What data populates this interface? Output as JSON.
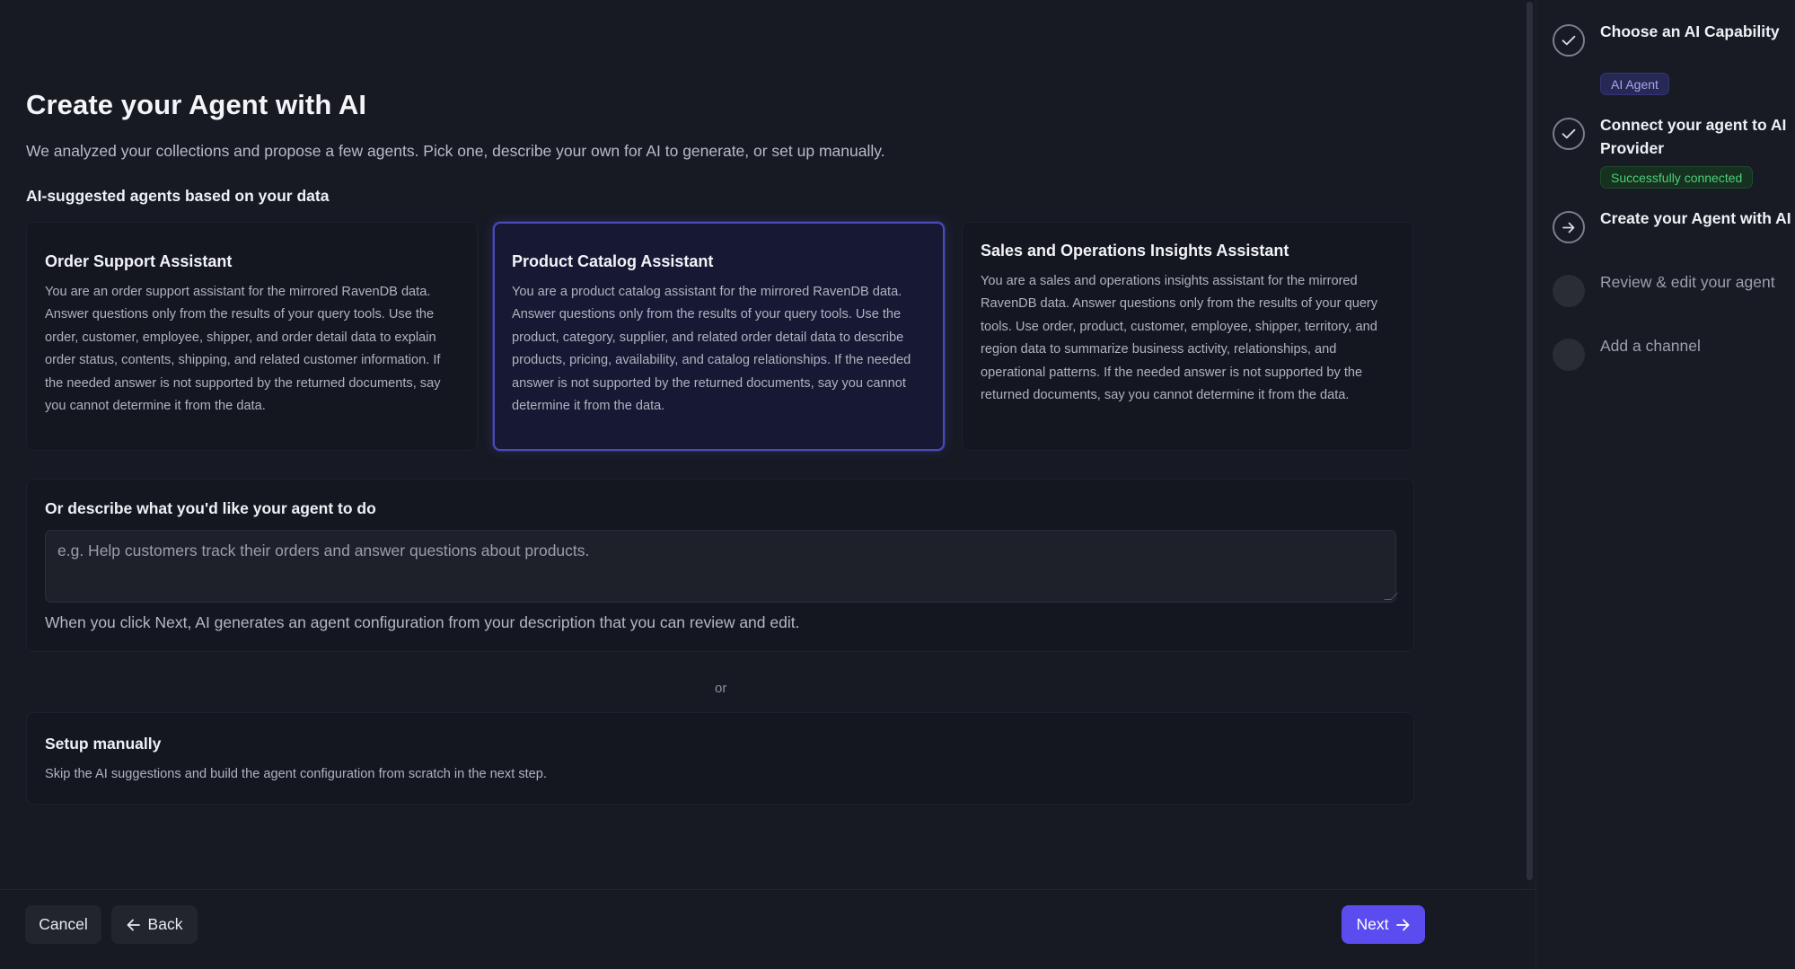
{
  "header": {
    "title": "Create your Agent with AI",
    "subtitle": "We analyzed your collections and propose a few agents. Pick one, describe your own for AI to generate, or set up manually.",
    "suggestions_label": "AI-suggested agents based on your data"
  },
  "cards": [
    {
      "title": "Order Support Assistant",
      "description": "You are an order support assistant for the mirrored RavenDB data. Answer questions only from the results of your query tools. Use the order, customer, employee, shipper, and order detail data to explain order status, contents, shipping, and related customer information. If the needed answer is not supported by the returned documents, say you cannot determine it from the data.",
      "selected": false
    },
    {
      "title": "Product Catalog Assistant",
      "description": "You are a product catalog assistant for the mirrored RavenDB data. Answer questions only from the results of your query tools. Use the product, category, supplier, and related order detail data to describe products, pricing, availability, and catalog relationships. If the needed answer is not supported by the returned documents, say you cannot determine it from the data.",
      "selected": true
    },
    {
      "title": "Sales and Operations Insights Assistant",
      "description": "You are a sales and operations insights assistant for the mirrored RavenDB data. Answer questions only from the results of your query tools. Use order, product, customer, employee, shipper, territory, and region data to summarize business activity, relationships, and operational patterns. If the needed answer is not supported by the returned documents, say you cannot determine it from the data.",
      "selected": false
    }
  ],
  "describe": {
    "label": "Or describe what you'd like your agent to do",
    "placeholder": "e.g. Help customers track their orders and answer questions about products.",
    "value": "",
    "help": "When you click Next, AI generates an agent configuration from your description that you can review and edit."
  },
  "divider_text": "or",
  "manual": {
    "title": "Setup manually",
    "description": "Skip the AI suggestions and build the agent configuration from scratch in the next step."
  },
  "footer": {
    "cancel_label": "Cancel",
    "back_label": "Back",
    "next_label": "Next"
  },
  "steps": [
    {
      "title": "Choose an AI Capability",
      "status": "done",
      "badge": "AI Agent",
      "badge_color": "#a7a8f0",
      "icon": "check-icon"
    },
    {
      "title": "Connect your agent to AI Provider",
      "status": "done",
      "badge": "Successfully connected",
      "badge_color": "#4bd07a",
      "icon": "check-icon"
    },
    {
      "title": "Create your Agent with AI",
      "status": "current",
      "icon": "arrow-right-icon"
    },
    {
      "title": "Review & edit your agent",
      "status": "pending"
    },
    {
      "title": "Add a channel",
      "status": "pending"
    }
  ],
  "colors": {
    "accent": "#5b4cf0",
    "background": "#171a23",
    "selected_border": "#4a4bb6"
  }
}
